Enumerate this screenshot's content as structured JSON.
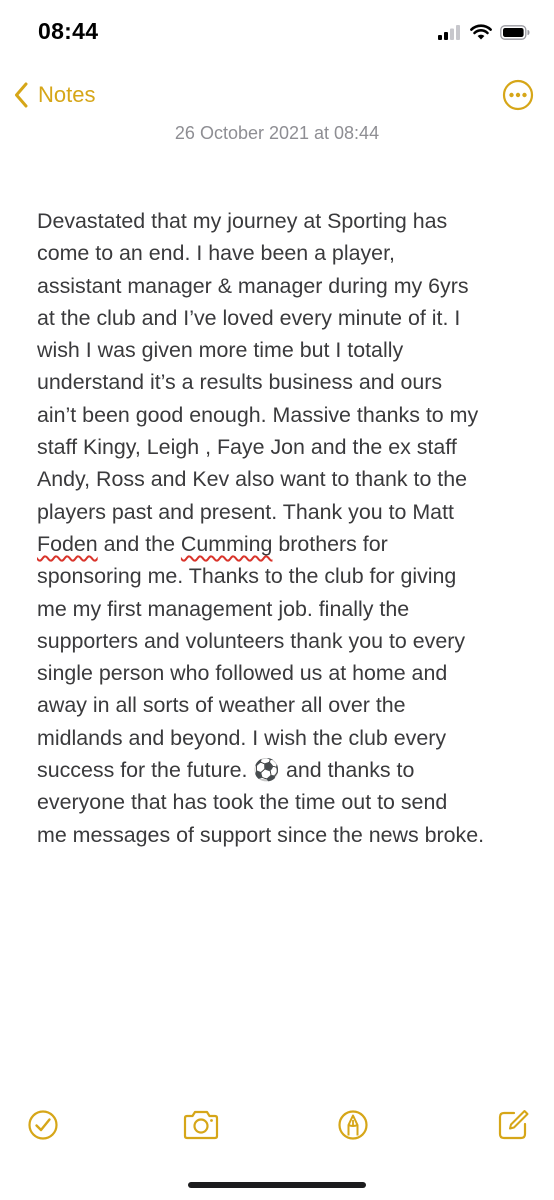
{
  "status_bar": {
    "time": "08:44",
    "icons": [
      "cellular-signal-icon",
      "wifi-icon",
      "battery-icon"
    ]
  },
  "nav": {
    "back_label": "Notes",
    "back_icon": "chevron-left-icon",
    "more_icon": "ellipsis-circle-icon"
  },
  "note": {
    "date": "26 October 2021 at 08:44",
    "lines": [
      "Devastated that my journey at Sporting has",
      "come to an end. I have been a player,",
      "assistant manager & manager during my 6yrs",
      "at the club and I’ve loved every minute of it. I",
      "wish I was given more time but I totally",
      "understand it’s a results business and ours",
      "ain’t been good enough. Massive thanks to my",
      "staff Kingy, Leigh , Faye Jon and the ex staff",
      "Andy, Ross and Kev also want to thank to the",
      "players past and present. Thank you to Matt",
      {
        "pre": "",
        "flag1": "Foden",
        "mid": " and the ",
        "flag2": "Cumming",
        "post": " brothers for"
      },
      "sponsoring me. Thanks to the club for giving",
      "me my first management job. finally the",
      "supporters and volunteers thank you to every",
      "single person who followed us at home and",
      "away in all sorts of weather all over the",
      "midlands and beyond. I wish the club every",
      "success for the future. ⚽ and thanks to",
      "everyone that has took the time out to send",
      "me messages of support since the news broke."
    ]
  },
  "toolbar": {
    "icons": [
      "checklist-icon",
      "camera-icon",
      "markup-pen-icon",
      "compose-icon"
    ]
  },
  "colors": {
    "accent": "#d6a618",
    "text": "#3a3a3c",
    "date": "#8e8e93",
    "spellcheck": "#d9342b"
  }
}
